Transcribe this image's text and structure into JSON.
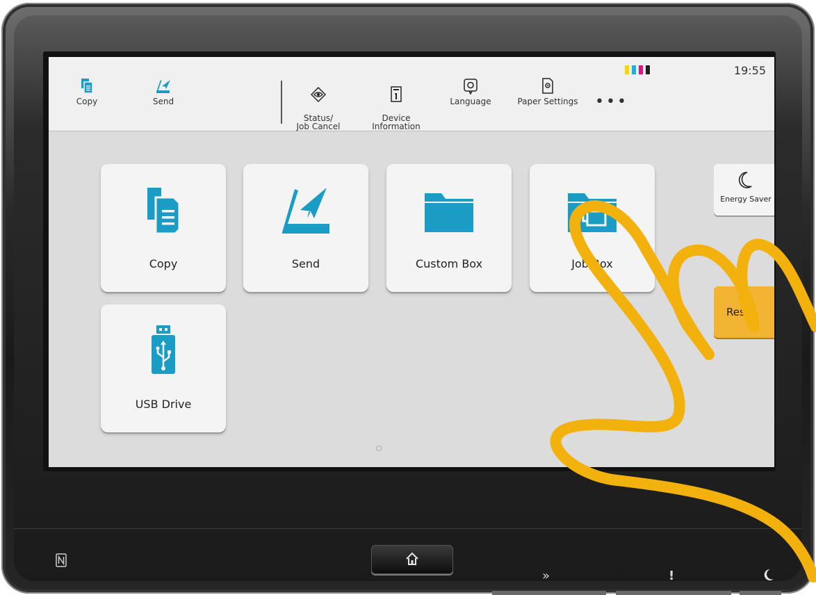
{
  "status_bar": {
    "time": "19:55",
    "toner_colors": [
      "#f5d800",
      "#1bb0e0",
      "#e2157a",
      "#222222"
    ]
  },
  "topbar": {
    "items": [
      {
        "label": "Copy",
        "icon": "copy-icon"
      },
      {
        "label": "Send",
        "icon": "send-icon"
      },
      {
        "label": "Status/\nJob Cancel",
        "icon": "status-eye-icon"
      },
      {
        "label": "Device\nInformation",
        "icon": "device-info-icon"
      },
      {
        "label": "Language",
        "icon": "language-icon"
      },
      {
        "label": "Paper Settings",
        "icon": "paper-settings-icon"
      }
    ],
    "more": "•••"
  },
  "tiles": [
    {
      "label": "Copy",
      "icon": "copy-icon"
    },
    {
      "label": "Send",
      "icon": "send-icon"
    },
    {
      "label": "Custom Box",
      "icon": "folder-icon"
    },
    {
      "label": "Job Box",
      "icon": "job-box-icon"
    },
    {
      "label": "USB Drive",
      "icon": "usb-drive-icon"
    }
  ],
  "side_buttons": {
    "energy_saver": "Energy Saver",
    "reset": "Reset"
  },
  "colors": {
    "accent": "#1a9cc5",
    "reset_button": "#f4b433",
    "scribble": "#f2b10c"
  },
  "hardware_keys": {
    "home": "home-icon",
    "nfc": "nfc-icon",
    "forward": "»",
    "attention": "!",
    "sleep": "moon-icon"
  }
}
